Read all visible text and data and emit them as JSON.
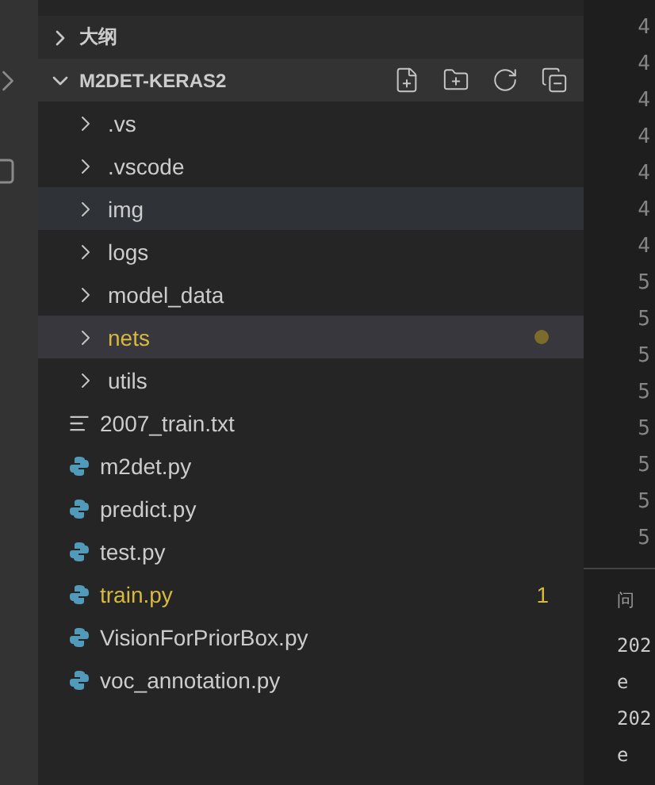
{
  "explorer": {
    "sections": [
      {
        "title": "大纲",
        "expanded": false
      }
    ],
    "folder": {
      "title": "M2DET-KERAS2",
      "expanded": true,
      "items": [
        {
          "kind": "folder",
          "label": ".vs",
          "selected": false,
          "hovered": false,
          "modified": false
        },
        {
          "kind": "folder",
          "label": ".vscode",
          "selected": false,
          "hovered": false,
          "modified": false
        },
        {
          "kind": "folder",
          "label": "img",
          "selected": false,
          "hovered": true,
          "modified": false
        },
        {
          "kind": "folder",
          "label": "logs",
          "selected": false,
          "hovered": false,
          "modified": false
        },
        {
          "kind": "folder",
          "label": "model_data",
          "selected": false,
          "hovered": false,
          "modified": false
        },
        {
          "kind": "folder",
          "label": "nets",
          "selected": true,
          "hovered": false,
          "modified": true
        },
        {
          "kind": "folder",
          "label": "utils",
          "selected": false,
          "hovered": false,
          "modified": false
        },
        {
          "kind": "text",
          "label": "2007_train.txt",
          "selected": false,
          "hovered": false,
          "modified": false
        },
        {
          "kind": "python",
          "label": "m2det.py",
          "selected": false,
          "hovered": false,
          "modified": false
        },
        {
          "kind": "python",
          "label": "predict.py",
          "selected": false,
          "hovered": false,
          "modified": false
        },
        {
          "kind": "python",
          "label": "test.py",
          "selected": false,
          "hovered": false,
          "modified": false
        },
        {
          "kind": "python",
          "label": "train.py",
          "selected": false,
          "hovered": false,
          "modified": true,
          "problems": "1"
        },
        {
          "kind": "python",
          "label": "VisionForPriorBox.py",
          "selected": false,
          "hovered": false,
          "modified": false
        },
        {
          "kind": "python",
          "label": "voc_annotation.py",
          "selected": false,
          "hovered": false,
          "modified": false
        }
      ]
    }
  },
  "editor": {
    "line_numbers": [
      "4",
      "4",
      "4",
      "4",
      "4",
      "4",
      "4",
      "5",
      "5",
      "5",
      "5",
      "5",
      "5",
      "5",
      "5"
    ]
  },
  "panel": {
    "tab": "问",
    "lines": [
      "202",
      "e",
      "202",
      "e"
    ]
  }
}
